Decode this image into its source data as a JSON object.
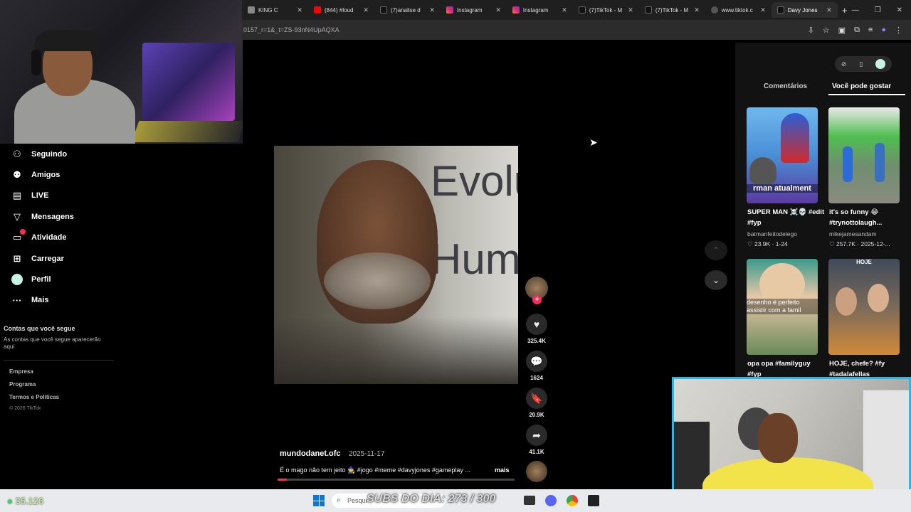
{
  "browser": {
    "tabs": [
      {
        "label": "KING C",
        "color": "#999"
      },
      {
        "label": "(844) #loud",
        "color": "#ff0000"
      },
      {
        "label": "(7)analise d",
        "color": "#fff"
      },
      {
        "label": "Instagram",
        "color": "#e1306c"
      },
      {
        "label": "Instagram",
        "color": "#e1306c"
      },
      {
        "label": "(7)TikTok - M",
        "color": "#fff"
      },
      {
        "label": "(7)TikTok - M",
        "color": "#fff"
      },
      {
        "label": "www.tiktok.c",
        "color": "#aaa"
      },
      {
        "label": "Davy Jones",
        "color": "#fff"
      }
    ],
    "url": "0157_r=1&_t=ZS-93nN4UpAQXA"
  },
  "sidebar": {
    "items": [
      {
        "label": "Seguindo",
        "icon": "people-icon"
      },
      {
        "label": "Amigos",
        "icon": "friends-icon"
      },
      {
        "label": "LIVE",
        "icon": "live-icon"
      },
      {
        "label": "Mensagens",
        "icon": "send-icon"
      },
      {
        "label": "Atividade",
        "icon": "activity-icon"
      },
      {
        "label": "Carregar",
        "icon": "upload-icon"
      },
      {
        "label": "Perfil",
        "icon": "avatar"
      },
      {
        "label": "Mais",
        "icon": "more-icon"
      }
    ],
    "following_title": "Contas que você segue",
    "following_desc": "As contas que você segue aparecerão aqui",
    "footer": [
      "Empresa",
      "Programa",
      "Termos e Políticas",
      "© 2026 TikTok"
    ]
  },
  "video": {
    "author": "mundodanet.ofc",
    "date": "2025-11-17",
    "caption": "É o mago não tem jeito 🧙 #jogo #meme #davyjones #gameplay ...",
    "more": "mais",
    "overlay_words": [
      "Evolu",
      "Hum"
    ],
    "likes": "325.4K",
    "comments": "1624",
    "saves": "20.9K",
    "shares": "41.1K"
  },
  "right": {
    "tabs": [
      "Comentários",
      "Você pode gostar"
    ],
    "cards": [
      {
        "title": "SUPER MAN ☠️💀 #edit #fyp",
        "author": "batmanfeitodelego",
        "likes": "23.9K",
        "date": "1-24",
        "thumb_text": "rman atualment"
      },
      {
        "title": "it's so funny 😂 #trynottolaugh...",
        "author": "mikejamesandam",
        "likes": "257.7K",
        "date": "2025-12-..."
      },
      {
        "title": "opa opa #familyguy #fyp",
        "author": "",
        "likes": "",
        "date": "",
        "thumb_text": "desenho é perfeito assistir com a famil"
      },
      {
        "title": "HOJE, chefe? #fy #tadalafellas",
        "author": "",
        "likes": "",
        "date": "",
        "thumb_text": "HOJE"
      }
    ]
  },
  "taskbar": {
    "viewers": "35.126",
    "search_placeholder": "Pesqui",
    "subs_overlay": "SUBS DO DIA: 273 / 300"
  }
}
